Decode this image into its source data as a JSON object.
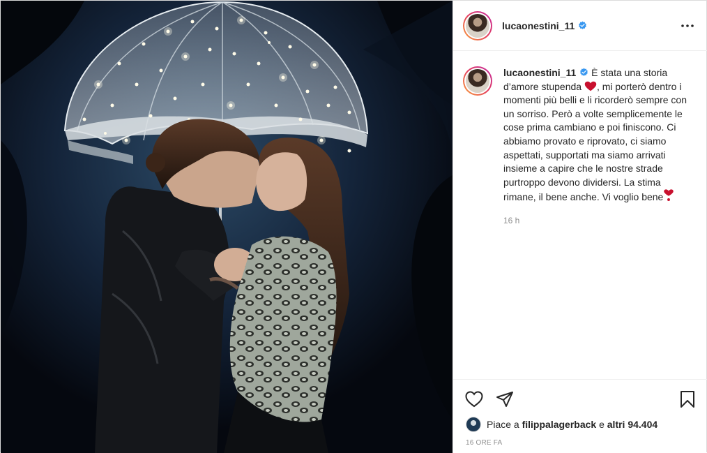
{
  "post": {
    "username": "lucaonestini_11",
    "verified": true,
    "caption_parts": [
      "È stata una storia d’amore stupenda",
      ", mi porterò dentro i momenti più belli e li ricorderò sempre con un sorriso. Però a volte semplicemente le cose prima cambiano e poi finiscono. Ci abbiamo provato e riprovato, ci siamo aspettati, supportati ma siamo arrivati insieme a capire che le nostre strade purtroppo devono dividersi. La stima rimane, il bene anche. Vi voglio bene"
    ],
    "caption_time": "16 h",
    "likes_prefix": "Piace a",
    "likes_user": "filippalagerback",
    "likes_conj": "e",
    "likes_rest": "altri 94.404",
    "post_time": "16 ORE FA"
  },
  "icons": {
    "more": "more-options-icon",
    "like": "heart-outline-icon",
    "share": "paper-plane-icon",
    "save": "bookmark-icon",
    "verified": "verified-badge-icon",
    "emoji": "red-heart-emoji"
  },
  "colors": {
    "verified": "#3897f0",
    "emoji_heart": "#c8102e",
    "secondary_text": "#8e8e8e"
  }
}
